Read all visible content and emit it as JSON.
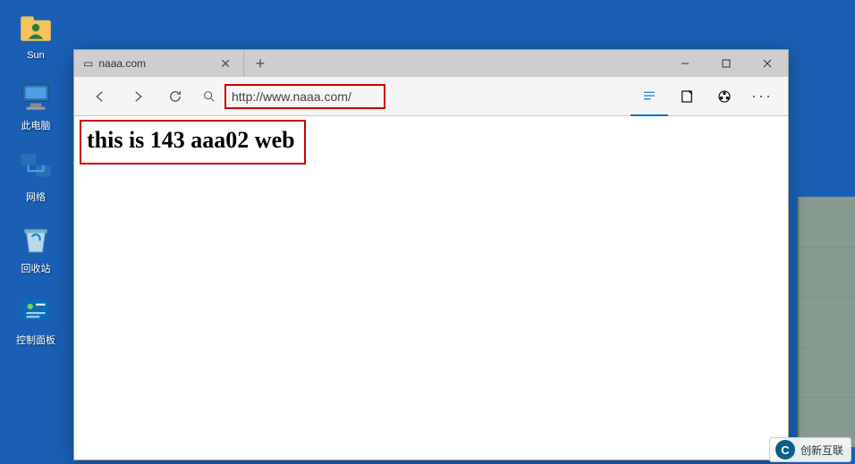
{
  "desktop": {
    "icons": [
      {
        "label": "Sun"
      },
      {
        "label": "此电脑"
      },
      {
        "label": "网络"
      },
      {
        "label": "回收站"
      },
      {
        "label": "控制面板"
      }
    ]
  },
  "browser": {
    "tab": {
      "title": "naaa.com"
    },
    "url": "http://www.naaa.com/",
    "content_heading": "this is 143 aaa02 web"
  },
  "highlight": {
    "url_box_color": "#c00",
    "content_box_color": "#c00"
  },
  "watermark": {
    "brand_letter": "C",
    "text": "创新互联"
  }
}
